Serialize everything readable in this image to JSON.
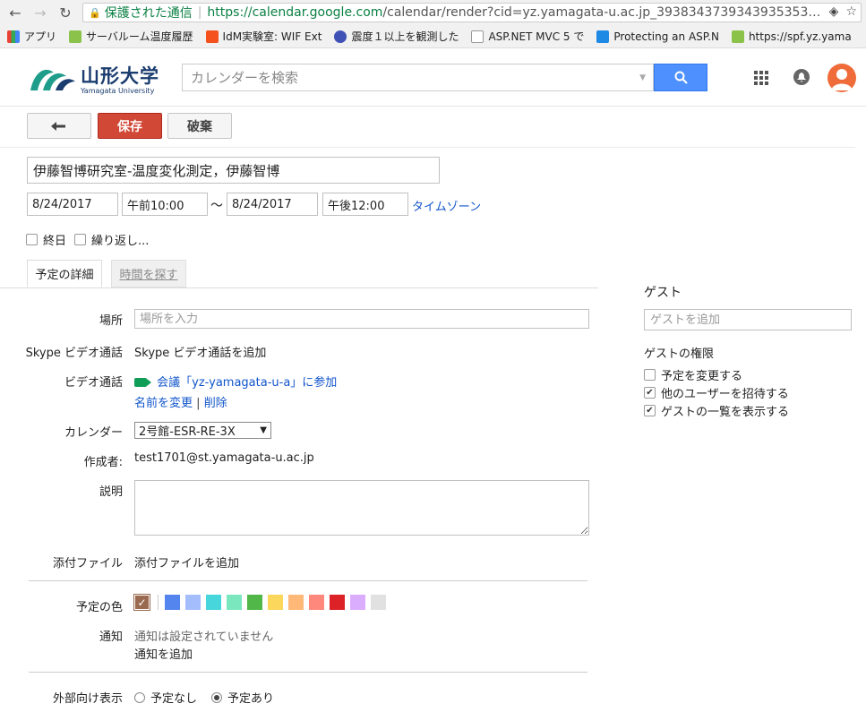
{
  "browser": {
    "secure_label": "保護された通信",
    "url_host": "https://calendar.google.com",
    "url_rest": "/calendar/render?cid=yz.yamagata-u.ac.jp_3938343739343935353…"
  },
  "bookmarks": [
    {
      "label": "アプリ",
      "color": "#e94235"
    },
    {
      "label": "サーバルーム温度履歴",
      "color": "#8bc34a"
    },
    {
      "label": "IdM実験室: WIF Ext",
      "color": "#f4511e"
    },
    {
      "label": "震度１以上を観測した",
      "color": "#3f51b5"
    },
    {
      "label": "ASP.NET MVC 5 で",
      "color": "#9e9e9e"
    },
    {
      "label": "Protecting an ASP.N",
      "color": "#1e88e5"
    },
    {
      "label": "https://spf.yz.yama",
      "color": "#8bc34a"
    }
  ],
  "header": {
    "logo_jp": "山形大学",
    "logo_en": "Yamagata University",
    "search_placeholder": "カレンダーを検索"
  },
  "actions": {
    "save": "保存",
    "discard": "破棄"
  },
  "event": {
    "title": "伊藤智博研究室-温度変化測定，伊藤智博",
    "start_date": "8/24/2017",
    "start_time": "午前10:00",
    "separator": "～",
    "end_date": "8/24/2017",
    "end_time": "午後12:00",
    "timezone_link": "タイムゾーン",
    "all_day": "終日",
    "repeat": "繰り返し..."
  },
  "tabs": {
    "details": "予定の詳細",
    "find_time": "時間を探す"
  },
  "form": {
    "location_label": "場所",
    "location_placeholder": "場所を入力",
    "skype_label": "Skype ビデオ通話",
    "skype_link": "Skype ビデオ通話を追加",
    "video_label": "ビデオ通話",
    "video_link": "会議「yz-yamagata-u-a」に参加",
    "rename_link": "名前を変更",
    "pipe": "|",
    "delete_link": "削除",
    "calendar_label": "カレンダー",
    "calendar_value": "2号館-ESR-RE-3X",
    "creator_label": "作成者:",
    "creator_value": "test1701@st.yamagata-u.ac.jp",
    "description_label": "説明",
    "attachment_label": "添付ファイル",
    "attachment_link": "添付ファイルを追加",
    "color_label": "予定の色",
    "colors": [
      "#a47ae2",
      "#5484ed",
      "#a4bdfc",
      "#46d6db",
      "#7ae7bf",
      "#51b749",
      "#fbd75b",
      "#ffb878",
      "#ff887c",
      "#dc2127",
      "#dbadff",
      "#e1e1e1"
    ],
    "selected_color": "#9a6a50",
    "notify_label": "通知",
    "notify_none": "通知は設定されていません",
    "notify_add": "通知を追加",
    "visibility_label": "外部向け表示",
    "visibility_free": "予定なし",
    "visibility_busy": "予定あり"
  },
  "guests": {
    "title": "ゲスト",
    "add_placeholder": "ゲストを追加",
    "perm_title": "ゲストの権限",
    "perm_modify": "予定を変更する",
    "perm_invite": "他のユーザーを招待する",
    "perm_see": "ゲストの一覧を表示する"
  }
}
